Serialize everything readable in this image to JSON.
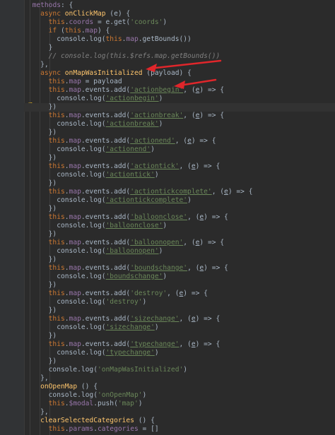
{
  "code_lines": [
    {
      "indent": "  ",
      "tokens": [
        {
          "t": "methods",
          "c": "prop"
        },
        {
          "t": ": {",
          "c": "tx"
        }
      ]
    },
    {
      "indent": "    ",
      "tokens": [
        {
          "t": "async ",
          "c": "kw"
        },
        {
          "t": "onClickMap",
          "c": "fn"
        },
        {
          "t": " (e) {",
          "c": "tx"
        }
      ]
    },
    {
      "indent": "      ",
      "tokens": [
        {
          "t": "this",
          "c": "kw"
        },
        {
          "t": ".",
          "c": "tx"
        },
        {
          "t": "coords",
          "c": "prop"
        },
        {
          "t": " = e.get(",
          "c": "tx"
        },
        {
          "t": "'coords'",
          "c": "str"
        },
        {
          "t": ")",
          "c": "tx"
        }
      ]
    },
    {
      "indent": "      ",
      "tokens": [
        {
          "t": "if ",
          "c": "kw"
        },
        {
          "t": "(",
          "c": "tx"
        },
        {
          "t": "this",
          "c": "kw"
        },
        {
          "t": ".",
          "c": "tx"
        },
        {
          "t": "map",
          "c": "prop"
        },
        {
          "t": ") {",
          "c": "tx"
        }
      ]
    },
    {
      "indent": "        ",
      "tokens": [
        {
          "t": "console.log(",
          "c": "tx"
        },
        {
          "t": "this",
          "c": "kw"
        },
        {
          "t": ".",
          "c": "tx"
        },
        {
          "t": "map",
          "c": "prop"
        },
        {
          "t": ".getBounds())",
          "c": "tx"
        }
      ]
    },
    {
      "indent": "      ",
      "tokens": [
        {
          "t": "}",
          "c": "tx"
        }
      ]
    },
    {
      "indent": "      ",
      "tokens": [
        {
          "t": "// console.log(this.$refs.map.getBounds())",
          "c": "cm"
        }
      ]
    },
    {
      "indent": "    ",
      "tokens": [
        {
          "t": "},",
          "c": "tx"
        }
      ]
    },
    {
      "indent": "    ",
      "tokens": [
        {
          "t": "async ",
          "c": "kw"
        },
        {
          "t": "onMapWasInitialized",
          "c": "fn"
        },
        {
          "t": " (payload) {",
          "c": "tx"
        }
      ]
    },
    {
      "indent": "      ",
      "tokens": [
        {
          "t": "this",
          "c": "kw"
        },
        {
          "t": ".",
          "c": "tx"
        },
        {
          "t": "map",
          "c": "prop"
        },
        {
          "t": " = payload",
          "c": "tx"
        }
      ]
    },
    {
      "indent": "      ",
      "tokens": [
        {
          "t": "this",
          "c": "kw"
        },
        {
          "t": ".",
          "c": "tx"
        },
        {
          "t": "map",
          "c": "prop"
        },
        {
          "t": ".events.add(",
          "c": "tx"
        },
        {
          "t": "'actionbegin'",
          "c": "str",
          "u": true
        },
        {
          "t": ", (",
          "c": "tx"
        },
        {
          "t": "e",
          "c": "tx",
          "u": true
        },
        {
          "t": ") => {",
          "c": "tx"
        }
      ]
    },
    {
      "indent": "        ",
      "tokens": [
        {
          "t": "console.log(",
          "c": "tx"
        },
        {
          "t": "'actionbegin'",
          "c": "str",
          "u": true
        },
        {
          "t": ")",
          "c": "tx"
        }
      ]
    },
    {
      "indent": "      ",
      "tokens": [
        {
          "t": "})",
          "c": "tx"
        }
      ],
      "hl": true
    },
    {
      "indent": "      ",
      "tokens": [
        {
          "t": "this",
          "c": "kw"
        },
        {
          "t": ".",
          "c": "tx"
        },
        {
          "t": "map",
          "c": "prop"
        },
        {
          "t": ".events.add(",
          "c": "tx"
        },
        {
          "t": "'actionbreak'",
          "c": "str",
          "u": true
        },
        {
          "t": ", (",
          "c": "tx"
        },
        {
          "t": "e",
          "c": "tx",
          "u": true
        },
        {
          "t": ") => {",
          "c": "tx"
        }
      ]
    },
    {
      "indent": "        ",
      "tokens": [
        {
          "t": "console.log(",
          "c": "tx"
        },
        {
          "t": "'actionbreak'",
          "c": "str",
          "u": true
        },
        {
          "t": ")",
          "c": "tx"
        }
      ]
    },
    {
      "indent": "      ",
      "tokens": [
        {
          "t": "})",
          "c": "tx"
        }
      ]
    },
    {
      "indent": "      ",
      "tokens": [
        {
          "t": "this",
          "c": "kw"
        },
        {
          "t": ".",
          "c": "tx"
        },
        {
          "t": "map",
          "c": "prop"
        },
        {
          "t": ".events.add(",
          "c": "tx"
        },
        {
          "t": "'actionend'",
          "c": "str",
          "u": true
        },
        {
          "t": ", (",
          "c": "tx"
        },
        {
          "t": "e",
          "c": "tx",
          "u": true
        },
        {
          "t": ") => {",
          "c": "tx"
        }
      ]
    },
    {
      "indent": "        ",
      "tokens": [
        {
          "t": "console.log(",
          "c": "tx"
        },
        {
          "t": "'actionend'",
          "c": "str",
          "u": true
        },
        {
          "t": ")",
          "c": "tx"
        }
      ]
    },
    {
      "indent": "      ",
      "tokens": [
        {
          "t": "})",
          "c": "tx"
        }
      ]
    },
    {
      "indent": "      ",
      "tokens": [
        {
          "t": "this",
          "c": "kw"
        },
        {
          "t": ".",
          "c": "tx"
        },
        {
          "t": "map",
          "c": "prop"
        },
        {
          "t": ".events.add(",
          "c": "tx"
        },
        {
          "t": "'actiontick'",
          "c": "str",
          "u": true
        },
        {
          "t": ", (",
          "c": "tx"
        },
        {
          "t": "e",
          "c": "tx",
          "u": true
        },
        {
          "t": ") => {",
          "c": "tx"
        }
      ]
    },
    {
      "indent": "        ",
      "tokens": [
        {
          "t": "console.log(",
          "c": "tx"
        },
        {
          "t": "'actiontick'",
          "c": "str",
          "u": true
        },
        {
          "t": ")",
          "c": "tx"
        }
      ]
    },
    {
      "indent": "      ",
      "tokens": [
        {
          "t": "})",
          "c": "tx"
        }
      ]
    },
    {
      "indent": "      ",
      "tokens": [
        {
          "t": "this",
          "c": "kw"
        },
        {
          "t": ".",
          "c": "tx"
        },
        {
          "t": "map",
          "c": "prop"
        },
        {
          "t": ".events.add(",
          "c": "tx"
        },
        {
          "t": "'actiontickcomplete'",
          "c": "str",
          "u": true
        },
        {
          "t": ", (",
          "c": "tx"
        },
        {
          "t": "e",
          "c": "tx",
          "u": true
        },
        {
          "t": ") => {",
          "c": "tx"
        }
      ]
    },
    {
      "indent": "        ",
      "tokens": [
        {
          "t": "console.log(",
          "c": "tx"
        },
        {
          "t": "'actiontickcomplete'",
          "c": "str",
          "u": true
        },
        {
          "t": ")",
          "c": "tx"
        }
      ]
    },
    {
      "indent": "      ",
      "tokens": [
        {
          "t": "})",
          "c": "tx"
        }
      ]
    },
    {
      "indent": "      ",
      "tokens": [
        {
          "t": "this",
          "c": "kw"
        },
        {
          "t": ".",
          "c": "tx"
        },
        {
          "t": "map",
          "c": "prop"
        },
        {
          "t": ".events.add(",
          "c": "tx"
        },
        {
          "t": "'balloonclose'",
          "c": "str",
          "u": true
        },
        {
          "t": ", (",
          "c": "tx"
        },
        {
          "t": "e",
          "c": "tx",
          "u": true
        },
        {
          "t": ") => {",
          "c": "tx"
        }
      ]
    },
    {
      "indent": "        ",
      "tokens": [
        {
          "t": "console.log(",
          "c": "tx"
        },
        {
          "t": "'balloonclose'",
          "c": "str",
          "u": true
        },
        {
          "t": ")",
          "c": "tx"
        }
      ]
    },
    {
      "indent": "      ",
      "tokens": [
        {
          "t": "})",
          "c": "tx"
        }
      ]
    },
    {
      "indent": "      ",
      "tokens": [
        {
          "t": "this",
          "c": "kw"
        },
        {
          "t": ".",
          "c": "tx"
        },
        {
          "t": "map",
          "c": "prop"
        },
        {
          "t": ".events.add(",
          "c": "tx"
        },
        {
          "t": "'balloonopen'",
          "c": "str",
          "u": true
        },
        {
          "t": ", (",
          "c": "tx"
        },
        {
          "t": "e",
          "c": "tx",
          "u": true
        },
        {
          "t": ") => {",
          "c": "tx"
        }
      ]
    },
    {
      "indent": "        ",
      "tokens": [
        {
          "t": "console.log(",
          "c": "tx"
        },
        {
          "t": "'balloonopen'",
          "c": "str",
          "u": true
        },
        {
          "t": ")",
          "c": "tx"
        }
      ]
    },
    {
      "indent": "      ",
      "tokens": [
        {
          "t": "})",
          "c": "tx"
        }
      ]
    },
    {
      "indent": "      ",
      "tokens": [
        {
          "t": "this",
          "c": "kw"
        },
        {
          "t": ".",
          "c": "tx"
        },
        {
          "t": "map",
          "c": "prop"
        },
        {
          "t": ".events.add(",
          "c": "tx"
        },
        {
          "t": "'boundschange'",
          "c": "str",
          "u": true
        },
        {
          "t": ", (",
          "c": "tx"
        },
        {
          "t": "e",
          "c": "tx",
          "u": true
        },
        {
          "t": ") => {",
          "c": "tx"
        }
      ]
    },
    {
      "indent": "        ",
      "tokens": [
        {
          "t": "console.log(",
          "c": "tx"
        },
        {
          "t": "'boundschange'",
          "c": "str",
          "u": true
        },
        {
          "t": ")",
          "c": "tx"
        }
      ]
    },
    {
      "indent": "      ",
      "tokens": [
        {
          "t": "})",
          "c": "tx"
        }
      ]
    },
    {
      "indent": "      ",
      "tokens": [
        {
          "t": "this",
          "c": "kw"
        },
        {
          "t": ".",
          "c": "tx"
        },
        {
          "t": "map",
          "c": "prop"
        },
        {
          "t": ".events.add(",
          "c": "tx"
        },
        {
          "t": "'destroy'",
          "c": "str"
        },
        {
          "t": ", (",
          "c": "tx"
        },
        {
          "t": "e",
          "c": "tx",
          "u": true
        },
        {
          "t": ") => {",
          "c": "tx"
        }
      ]
    },
    {
      "indent": "        ",
      "tokens": [
        {
          "t": "console.log(",
          "c": "tx"
        },
        {
          "t": "'destroy'",
          "c": "str"
        },
        {
          "t": ")",
          "c": "tx"
        }
      ]
    },
    {
      "indent": "      ",
      "tokens": [
        {
          "t": "})",
          "c": "tx"
        }
      ]
    },
    {
      "indent": "      ",
      "tokens": [
        {
          "t": "this",
          "c": "kw"
        },
        {
          "t": ".",
          "c": "tx"
        },
        {
          "t": "map",
          "c": "prop"
        },
        {
          "t": ".events.add(",
          "c": "tx"
        },
        {
          "t": "'sizechange'",
          "c": "str",
          "u": true
        },
        {
          "t": ", (",
          "c": "tx"
        },
        {
          "t": "e",
          "c": "tx",
          "u": true
        },
        {
          "t": ") => {",
          "c": "tx"
        }
      ]
    },
    {
      "indent": "        ",
      "tokens": [
        {
          "t": "console.log(",
          "c": "tx"
        },
        {
          "t": "'sizechange'",
          "c": "str",
          "u": true
        },
        {
          "t": ")",
          "c": "tx"
        }
      ]
    },
    {
      "indent": "      ",
      "tokens": [
        {
          "t": "})",
          "c": "tx"
        }
      ]
    },
    {
      "indent": "      ",
      "tokens": [
        {
          "t": "this",
          "c": "kw"
        },
        {
          "t": ".",
          "c": "tx"
        },
        {
          "t": "map",
          "c": "prop"
        },
        {
          "t": ".events.add(",
          "c": "tx"
        },
        {
          "t": "'typechange'",
          "c": "str",
          "u": true
        },
        {
          "t": ", (",
          "c": "tx"
        },
        {
          "t": "e",
          "c": "tx",
          "u": true
        },
        {
          "t": ") => {",
          "c": "tx"
        }
      ]
    },
    {
      "indent": "        ",
      "tokens": [
        {
          "t": "console.log(",
          "c": "tx"
        },
        {
          "t": "'typechange'",
          "c": "str",
          "u": true
        },
        {
          "t": ")",
          "c": "tx"
        }
      ]
    },
    {
      "indent": "      ",
      "tokens": [
        {
          "t": "})",
          "c": "tx"
        }
      ]
    },
    {
      "indent": "      ",
      "tokens": [
        {
          "t": "console.log(",
          "c": "tx"
        },
        {
          "t": "'onMapWasInitialized'",
          "c": "str"
        },
        {
          "t": ")",
          "c": "tx"
        }
      ]
    },
    {
      "indent": "    ",
      "tokens": [
        {
          "t": "},",
          "c": "tx"
        }
      ]
    },
    {
      "indent": "    ",
      "tokens": [
        {
          "t": "onOpenMap",
          "c": "fn"
        },
        {
          "t": " () {",
          "c": "tx"
        }
      ]
    },
    {
      "indent": "      ",
      "tokens": [
        {
          "t": "console.log(",
          "c": "tx"
        },
        {
          "t": "'onOpenMap'",
          "c": "str"
        },
        {
          "t": ")",
          "c": "tx"
        }
      ]
    },
    {
      "indent": "      ",
      "tokens": [
        {
          "t": "this",
          "c": "kw"
        },
        {
          "t": ".",
          "c": "tx"
        },
        {
          "t": "$modal",
          "c": "prop"
        },
        {
          "t": ".push(",
          "c": "tx"
        },
        {
          "t": "'map'",
          "c": "str"
        },
        {
          "t": ")",
          "c": "tx"
        }
      ]
    },
    {
      "indent": "    ",
      "tokens": [
        {
          "t": "},",
          "c": "tx"
        }
      ]
    },
    {
      "indent": "    ",
      "tokens": [
        {
          "t": "clearSelectedCategories",
          "c": "fn"
        },
        {
          "t": " () {",
          "c": "tx"
        }
      ]
    },
    {
      "indent": "      ",
      "tokens": [
        {
          "t": "this",
          "c": "kw"
        },
        {
          "t": ".",
          "c": "tx"
        },
        {
          "t": "params",
          "c": "prop"
        },
        {
          "t": ".",
          "c": "tx"
        },
        {
          "t": "categories",
          "c": "prop"
        },
        {
          "t": " = []",
          "c": "tx"
        }
      ]
    }
  ],
  "colors": {
    "background": "#2b2b2b",
    "gutter": "#313335",
    "keyword": "#cc7832",
    "function": "#ffc66d",
    "property": "#9876aa",
    "string": "#6a8759",
    "comment": "#808080",
    "text": "#a9b7c6",
    "annotation_arrow": "#e0262b",
    "bulb": "#e8b520"
  },
  "icons": {
    "gutter_marker": "lightbulb-icon",
    "annotations": [
      "red-arrow-icon",
      "red-arrow-icon"
    ]
  }
}
